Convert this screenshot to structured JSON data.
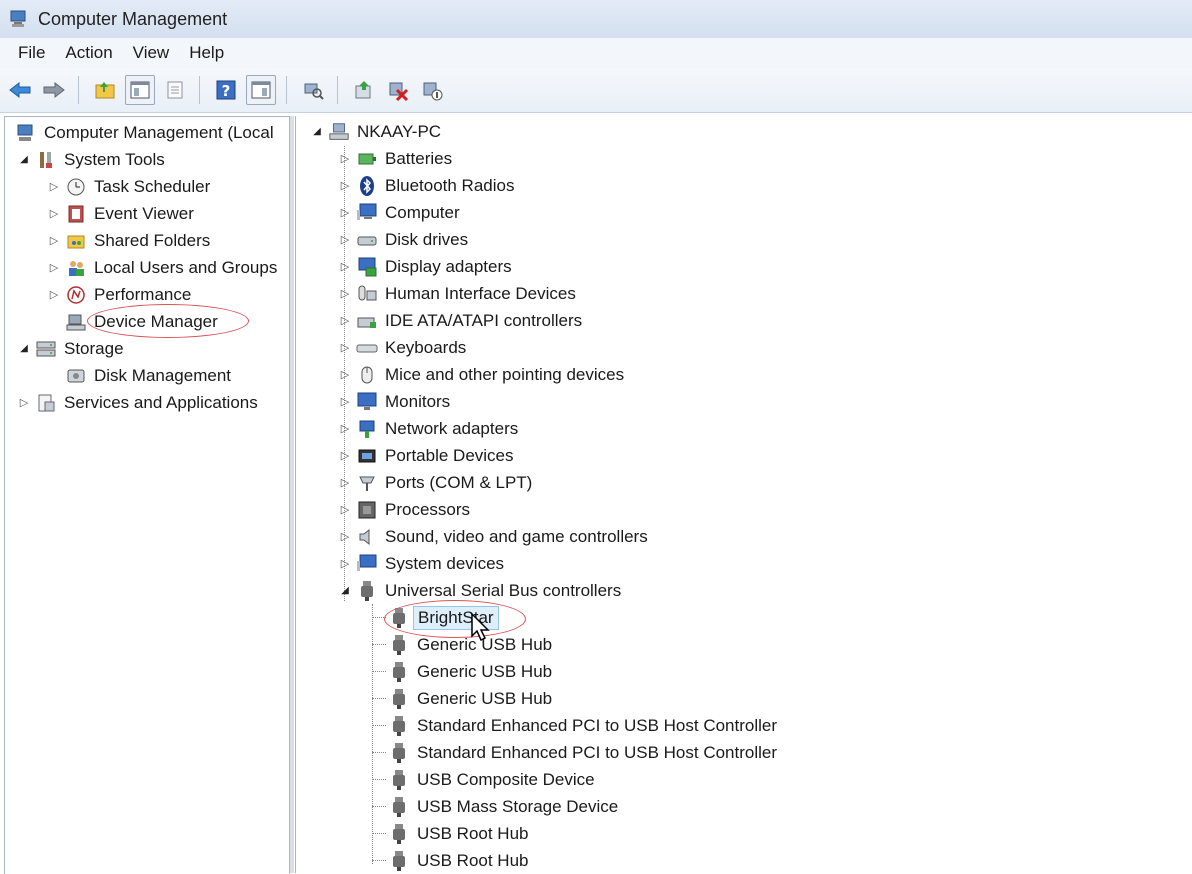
{
  "window": {
    "title": "Computer Management"
  },
  "menu": [
    "File",
    "Action",
    "View",
    "Help"
  ],
  "toolbar": {
    "buttons": [
      "back-icon",
      "forward-icon",
      "up-folder-icon",
      "show-hide-tree-icon",
      "properties-icon",
      "help-icon",
      "show-hide-action-pane-icon",
      "scan-hardware-icon",
      "update-driver-icon",
      "uninstall-icon",
      "disable-icon"
    ]
  },
  "left_tree": {
    "root": "Computer Management (Local",
    "system_tools": "System Tools",
    "task_scheduler": "Task Scheduler",
    "event_viewer": "Event Viewer",
    "shared_folders": "Shared Folders",
    "local_users": "Local Users and Groups",
    "performance": "Performance",
    "device_manager": "Device Manager",
    "storage": "Storage",
    "disk_management": "Disk Management",
    "services": "Services and Applications"
  },
  "device_tree": {
    "computer_name": "NKAAY-PC",
    "categories": [
      "Batteries",
      "Bluetooth Radios",
      "Computer",
      "Disk drives",
      "Display adapters",
      "Human Interface Devices",
      "IDE ATA/ATAPI controllers",
      "Keyboards",
      "Mice and other pointing devices",
      "Monitors",
      "Network adapters",
      "Portable Devices",
      "Ports (COM & LPT)",
      "Processors",
      "Sound, video and game controllers",
      "System devices"
    ],
    "usb_category": "Universal Serial Bus controllers",
    "usb_devices": [
      "BrightStar",
      "Generic USB Hub",
      "Generic USB Hub",
      "Generic USB Hub",
      "Standard Enhanced PCI to USB Host Controller",
      "Standard Enhanced PCI to USB Host Controller",
      "USB Composite Device",
      "USB Mass Storage Device",
      "USB Root Hub",
      "USB Root Hub"
    ]
  },
  "colors": {
    "highlight_circle": "#d9535a",
    "selection": "#dfeefb"
  }
}
